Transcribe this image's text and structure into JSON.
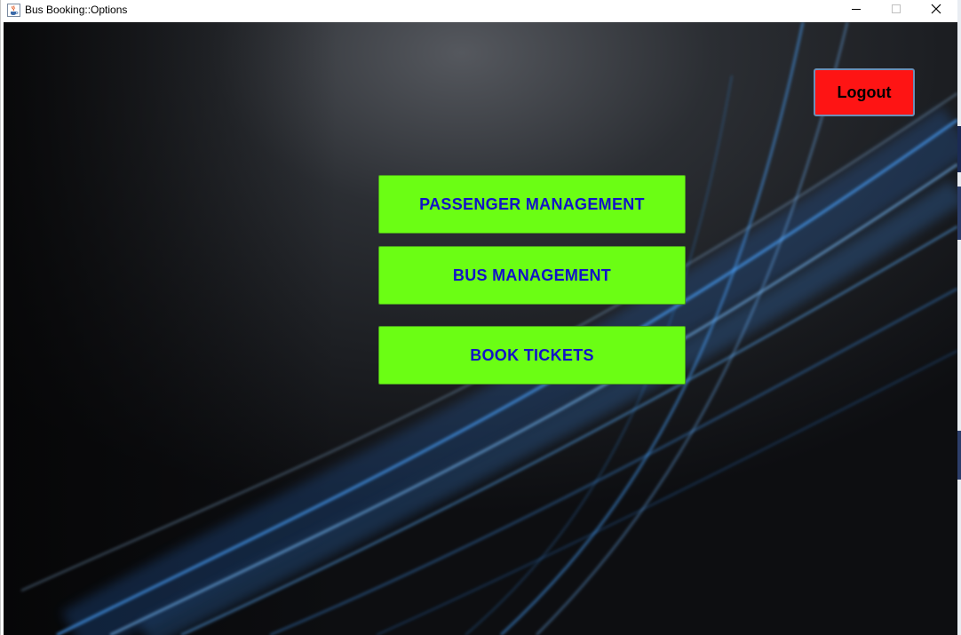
{
  "window": {
    "title": "Bus Booking::Options",
    "icon": "java-cup-icon",
    "controls": [
      "minimize-icon",
      "maximize-icon",
      "close-icon"
    ]
  },
  "menu": {
    "passenger_label": "PASSENGER MANAGEMENT",
    "bus_label": "BUS MANAGEMENT",
    "book_label": "BOOK TICKETS"
  },
  "actions": {
    "logout_label": "Logout"
  },
  "colors": {
    "menu_button_bg": "#6bfe14",
    "menu_button_text": "#1212c8",
    "logout_bg": "#fe1414",
    "background": "#15171b",
    "light_streak": "#4aa3ff"
  }
}
